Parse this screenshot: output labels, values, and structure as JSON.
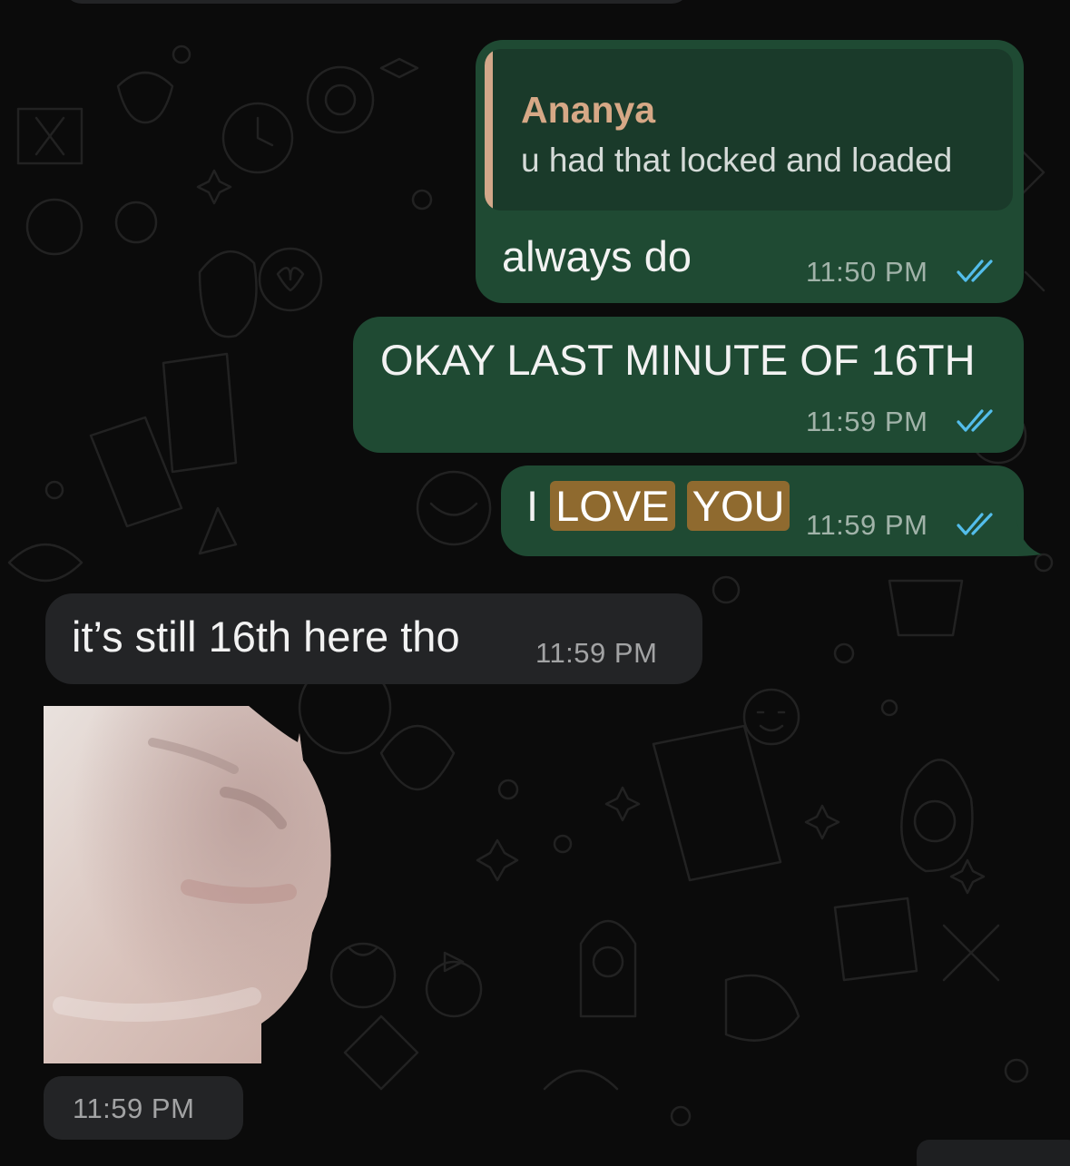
{
  "messages": [
    {
      "direction": "outgoing",
      "reply_to": {
        "author": "Ananya",
        "text": "u had that locked and loaded"
      },
      "text": "always do",
      "time": "11:50 PM",
      "status": "read"
    },
    {
      "direction": "outgoing",
      "text": "OKAY LAST MINUTE OF 16TH",
      "time": "11:59 PM",
      "status": "read"
    },
    {
      "direction": "outgoing",
      "text_parts": [
        "I",
        "LOVE",
        "YOU"
      ],
      "highlighted": [
        "LOVE",
        "YOU"
      ],
      "time": "11:59 PM",
      "status": "read"
    },
    {
      "direction": "incoming",
      "text": "it’s still 16th here tho",
      "time": "11:59 PM"
    },
    {
      "direction": "incoming",
      "type": "sticker",
      "sticker": "blurry-cat-face-sticker",
      "time": "11:59 PM"
    }
  ],
  "colors": {
    "background": "#0b0b0b",
    "outgoing_bubble": "#1f4a33",
    "incoming_bubble": "#232426",
    "quote_bar": "#d3a88a",
    "quote_author": "#d6a886",
    "read_ticks": "#53bdeb",
    "search_highlight": "#8f6a2f"
  },
  "icons": {
    "read_receipt": "double-check-icon"
  }
}
